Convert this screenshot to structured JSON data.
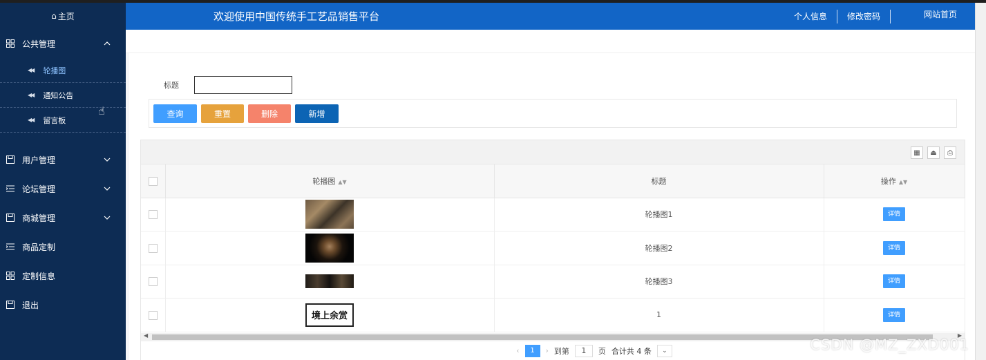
{
  "header": {
    "title": "欢迎使用中国传统手工艺品销售平台",
    "nav": [
      "个人信息",
      "修改密码",
      "网站首页"
    ]
  },
  "sidebar": {
    "home": "主页",
    "menus": [
      {
        "label": "公共管理",
        "icon": "grid-icon",
        "expanded": true,
        "children": [
          "轮播图",
          "通知公告",
          "留言板"
        ]
      },
      {
        "label": "用户管理",
        "icon": "save-icon"
      },
      {
        "label": "论坛管理",
        "icon": "list-indent-icon"
      },
      {
        "label": "商城管理",
        "icon": "save-icon"
      },
      {
        "label": "商品定制",
        "icon": "list-indent-icon"
      },
      {
        "label": "定制信息",
        "icon": "grid-icon"
      },
      {
        "label": "退出",
        "icon": "save-icon"
      }
    ]
  },
  "search": {
    "label": "标题",
    "value": ""
  },
  "buttons": {
    "query": "查询",
    "reset": "重置",
    "delete": "删除",
    "add": "新增"
  },
  "table": {
    "headers": [
      "轮播图",
      "标题",
      "操作"
    ],
    "rows": [
      {
        "title": "轮播图1",
        "action": "详情"
      },
      {
        "title": "轮播图2",
        "action": "详情"
      },
      {
        "title": "轮播图3",
        "action": "详情"
      },
      {
        "title": "1",
        "action": "详情"
      }
    ],
    "logo_text": "境上余赏"
  },
  "pager": {
    "current": "1",
    "goto": "到第",
    "page_input": "1",
    "page_unit": "页",
    "total": "合计共 4 条"
  },
  "watermark": "CSDN @MZ_ZXD001"
}
